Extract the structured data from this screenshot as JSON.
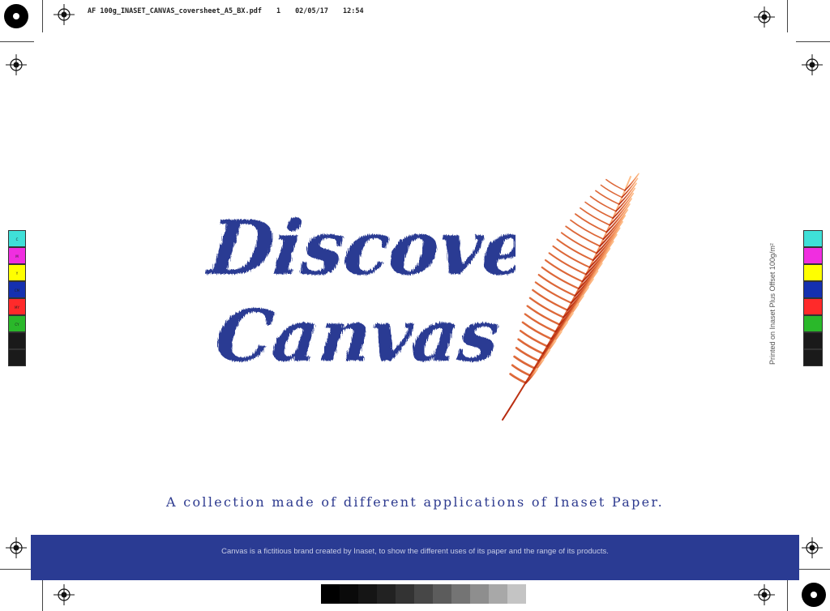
{
  "slug": {
    "filename": "AF 100g_INASET_CANVAS_coversheet_A5_BX.pdf",
    "page": "1",
    "date": "02/05/17",
    "time": "12:54"
  },
  "cover": {
    "headline_line1": "Discover",
    "headline_line2": "Canvas",
    "tagline": "A collection made of different applications of Inaset Paper.",
    "footer_note": "Canvas is a fictitious brand created by Inaset, to show the different uses of its paper and the range of its products.",
    "side_note": "Printed on Inaset Plus Offset 100g/m²",
    "headline_color": "#2a3b93",
    "footer_color": "#2a3b93"
  },
  "color_bar_left": [
    {
      "label": "C",
      "color": "#3fe0d8"
    },
    {
      "label": "M",
      "color": "#f02ee0"
    },
    {
      "label": "Y",
      "color": "#ffff00"
    },
    {
      "label": "CM",
      "color": "#1530b0"
    },
    {
      "label": "MY",
      "color": "#ff2a2a"
    },
    {
      "label": "CY",
      "color": "#2ab82a"
    },
    {
      "label": "",
      "color": "#1a1a1a"
    },
    {
      "label": "",
      "color": "#1a1a1a"
    }
  ],
  "color_bar_right": [
    "#3fe0d8",
    "#f02ee0",
    "#ffff00",
    "#1530b0",
    "#ff2a2a",
    "#2ab82a",
    "#1a1a1a",
    "#1a1a1a"
  ],
  "gray_steps": [
    "#000000",
    "#0a0a0a",
    "#151515",
    "#222222",
    "#333333",
    "#474747",
    "#5c5c5c",
    "#747474",
    "#8e8e8e",
    "#a8a8a8",
    "#c4c4c4"
  ]
}
